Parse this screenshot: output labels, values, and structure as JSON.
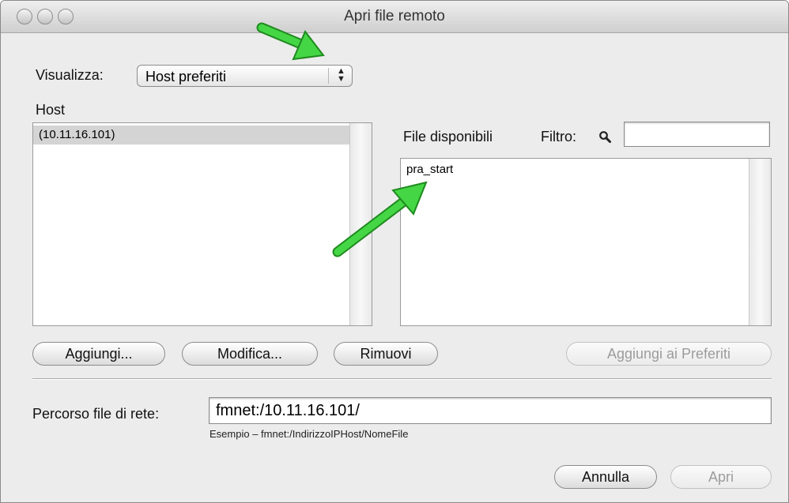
{
  "window": {
    "title": "Apri file remoto"
  },
  "view": {
    "label": "Visualizza:",
    "selected": "Host preferiti"
  },
  "hosts": {
    "label": "Host",
    "items": [
      "(10.11.16.101)"
    ]
  },
  "files": {
    "label": "File disponibili",
    "filter_label": "Filtro:",
    "filter_value": "",
    "items": [
      "pra_start"
    ]
  },
  "buttons": {
    "add": "Aggiungi...",
    "edit": "Modifica...",
    "remove": "Rimuovi",
    "add_favorites": "Aggiungi ai Preferiti"
  },
  "path": {
    "label": "Percorso file di rete:",
    "value": "fmnet:/10.11.16.101/",
    "example": "Esempio – fmnet:/IndirizzoIPHost/NomeFile"
  },
  "footer": {
    "cancel": "Annulla",
    "open": "Apri"
  },
  "colors": {
    "arrow": "#3fcf3f",
    "selection": "#d4d4d4",
    "window_bg": "#ececec"
  }
}
